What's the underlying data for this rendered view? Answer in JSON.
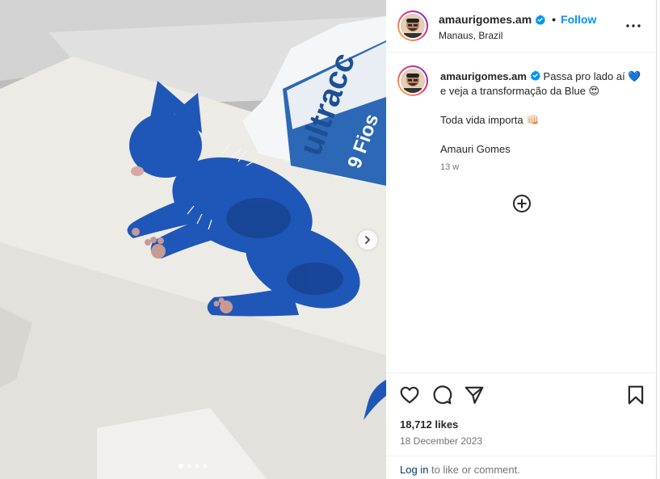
{
  "post": {
    "username": "amaurigomes.am",
    "separator": "•",
    "follow_label": "Follow",
    "location": "Manaus, Brazil",
    "caption_line1": " Passa pro lado aí 💙 e veja a transformação da Blue 😍",
    "caption_line2": "Toda vida importa 👊🏻",
    "caption_line3": "Amauri Gomes",
    "time_ago": "13 w",
    "likes": "18,712 likes",
    "date": "18 December 2023",
    "login_link": "Log in",
    "login_rest": " to like or comment.",
    "carousel_dots": 4,
    "carousel_index": 1
  },
  "photo_text": {
    "bag_brand": "ultracc",
    "bag_line": "9 Fios"
  },
  "icons": {
    "verified": "verified-badge-icon",
    "more": "more-options-icon",
    "like": "heart-icon",
    "comment": "comment-icon",
    "share": "share-icon",
    "save": "bookmark-icon",
    "add": "plus-circle-icon",
    "next": "chevron-right-icon"
  },
  "colors": {
    "accent": "#0095f6",
    "verified": "#0095f6",
    "link": "#00376b",
    "cat_blue": "#1f57b8"
  }
}
